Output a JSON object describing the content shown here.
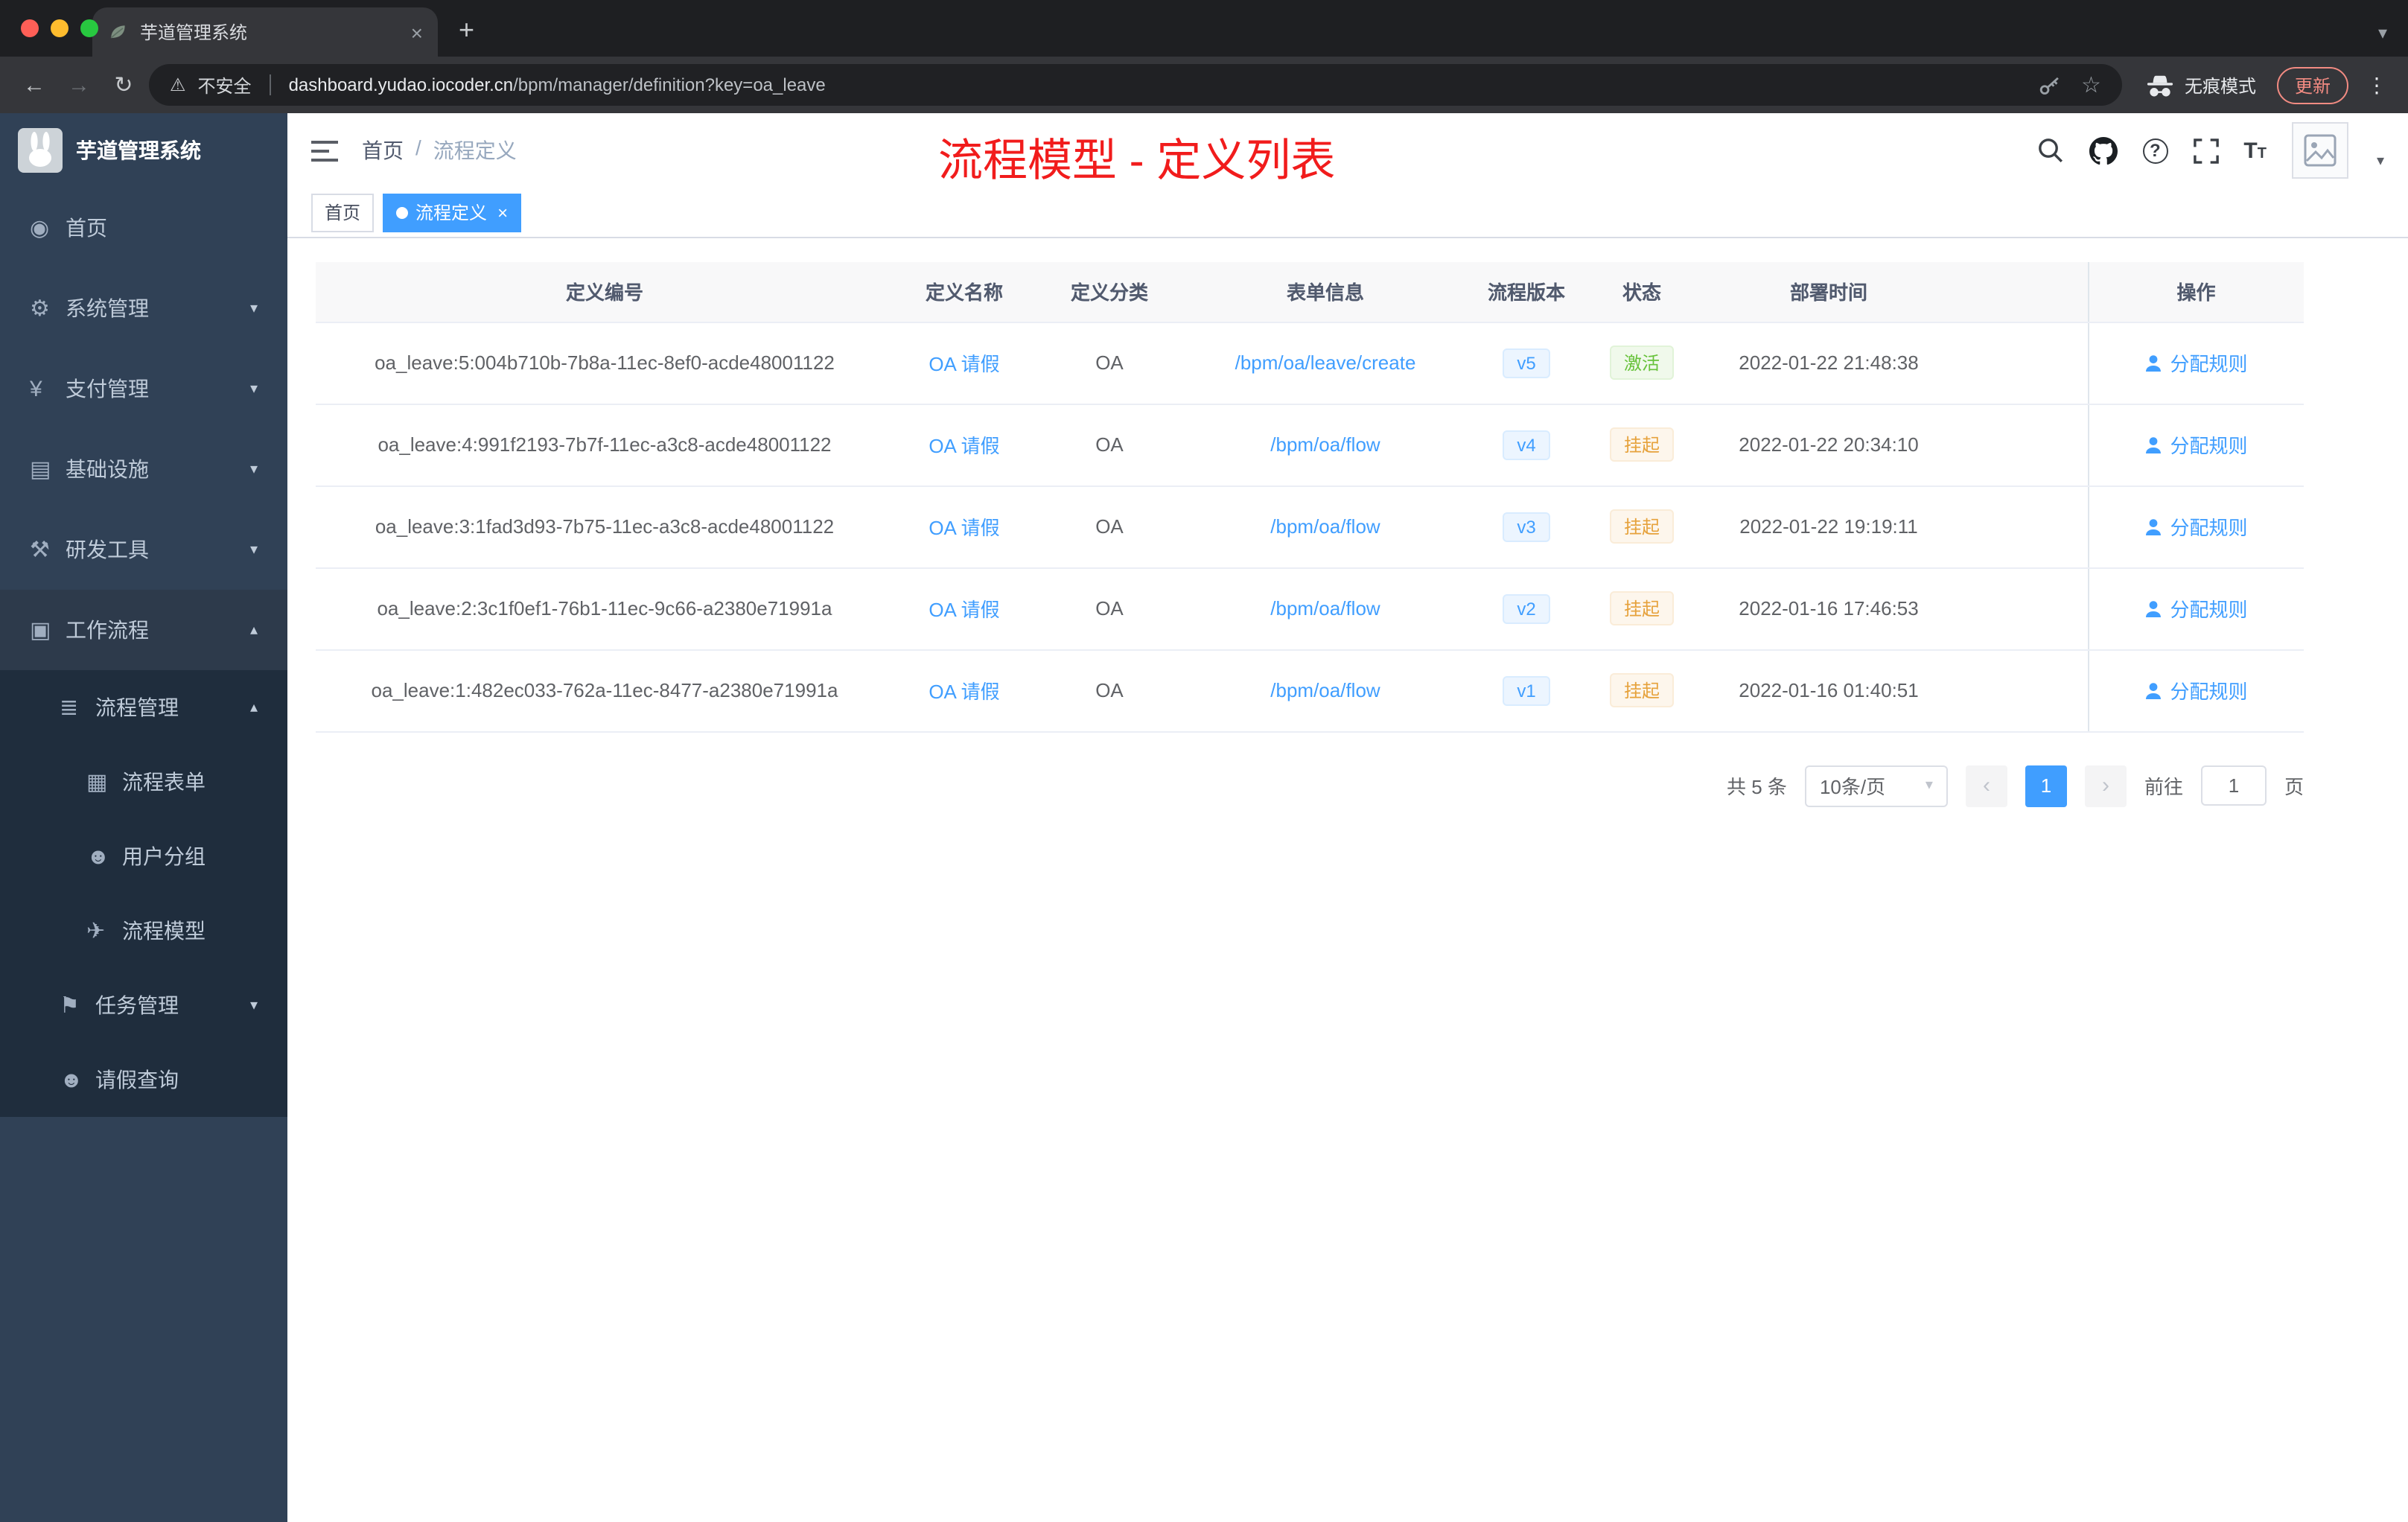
{
  "browser": {
    "tab_title": "芋道管理系统",
    "security_label": "不安全",
    "url_domain": "dashboard.yudao.iocoder.cn",
    "url_path": "/bpm/manager/definition?key=oa_leave",
    "incognito_label": "无痕模式",
    "update_label": "更新"
  },
  "icons": {
    "close": "×",
    "plus": "+",
    "back": "←",
    "forward": "→",
    "reload": "↻",
    "warning": "⚠",
    "star": "☆",
    "dots": "⋮",
    "caret_down": "▾",
    "caret_up": "▴",
    "chevron_left": "‹",
    "chevron_right": "›",
    "menu_home": "◉",
    "menu_system": "⚙",
    "menu_pay": "¥",
    "menu_infra": "▤",
    "menu_dev": "⚒",
    "menu_workflow": "▣",
    "menu_process": "≣",
    "menu_form": "▦",
    "menu_group": "☻",
    "menu_model": "✈",
    "menu_task": "⚑",
    "menu_leave": "☻"
  },
  "sidebar": {
    "logo_title": "芋道管理系统",
    "items": [
      {
        "label": "首页"
      },
      {
        "label": "系统管理"
      },
      {
        "label": "支付管理"
      },
      {
        "label": "基础设施"
      },
      {
        "label": "研发工具"
      },
      {
        "label": "工作流程"
      },
      {
        "label": "流程管理"
      },
      {
        "label": "流程表单"
      },
      {
        "label": "用户分组"
      },
      {
        "label": "流程模型"
      },
      {
        "label": "任务管理"
      },
      {
        "label": "请假查询"
      }
    ]
  },
  "navbar": {
    "breadcrumb_home": "首页",
    "breadcrumb_sep": "/",
    "breadcrumb_current": "流程定义",
    "annotation": "流程模型 - 定义列表"
  },
  "tags": {
    "home": "首页",
    "active": "流程定义"
  },
  "table": {
    "headers": {
      "id": "定义编号",
      "name": "定义名称",
      "category": "定义分类",
      "form": "表单信息",
      "version": "流程版本",
      "status": "状态",
      "deploy_time": "部署时间",
      "actions": "操作"
    },
    "rows": [
      {
        "id": "oa_leave:5:004b710b-7b8a-11ec-8ef0-acde48001122",
        "name": "OA 请假",
        "category": "OA",
        "form": "/bpm/oa/leave/create",
        "version": "v5",
        "status": "激活",
        "time": "2022-01-22 21:48:38",
        "action": "分配规则"
      },
      {
        "id": "oa_leave:4:991f2193-7b7f-11ec-a3c8-acde48001122",
        "name": "OA 请假",
        "category": "OA",
        "form": "/bpm/oa/flow",
        "version": "v4",
        "status": "挂起",
        "time": "2022-01-22 20:34:10",
        "action": "分配规则"
      },
      {
        "id": "oa_leave:3:1fad3d93-7b75-11ec-a3c8-acde48001122",
        "name": "OA 请假",
        "category": "OA",
        "form": "/bpm/oa/flow",
        "version": "v3",
        "status": "挂起",
        "time": "2022-01-22 19:19:11",
        "action": "分配规则"
      },
      {
        "id": "oa_leave:2:3c1f0ef1-76b1-11ec-9c66-a2380e71991a",
        "name": "OA 请假",
        "category": "OA",
        "form": "/bpm/oa/flow",
        "version": "v2",
        "status": "挂起",
        "time": "2022-01-16 17:46:53",
        "action": "分配规则"
      },
      {
        "id": "oa_leave:1:482ec033-762a-11ec-8477-a2380e71991a",
        "name": "OA 请假",
        "category": "OA",
        "form": "/bpm/oa/flow",
        "version": "v1",
        "status": "挂起",
        "time": "2022-01-16 01:40:51",
        "action": "分配规则"
      }
    ]
  },
  "pagination": {
    "total": "共 5 条",
    "page_size": "10条/页",
    "current": "1",
    "goto_label": "前往",
    "goto_value": "1",
    "goto_unit": "页"
  },
  "colors": {
    "accent": "#409eff",
    "success": "#67c23a",
    "warning": "#e6a23c",
    "annotation_red": "#f11c1c",
    "sidebar_bg": "#304156",
    "submenu_bg": "#1f2d3d"
  }
}
